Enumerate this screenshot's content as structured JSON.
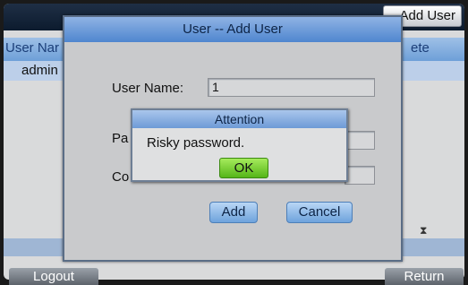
{
  "background": {
    "add_user_button": "Add User",
    "columns": {
      "username": "User Nar",
      "delete": "ete"
    },
    "rows": [
      "admin"
    ],
    "logout": "Logout",
    "return": "Return"
  },
  "dialog": {
    "title": "User -- Add User",
    "username_label": "User Name:",
    "username_value": "1",
    "password_label": "Pa",
    "confirm_label": "Co",
    "add_button": "Add",
    "cancel_button": "Cancel"
  },
  "attention": {
    "title": "Attention",
    "message": "Risky password.",
    "ok_button": "OK"
  },
  "icons": {
    "hourglass": "hourglass-icon"
  },
  "colors": {
    "accent_blue": "#6ea3dc",
    "ok_green": "#55b518",
    "title_navy": "#0c1b2e"
  }
}
